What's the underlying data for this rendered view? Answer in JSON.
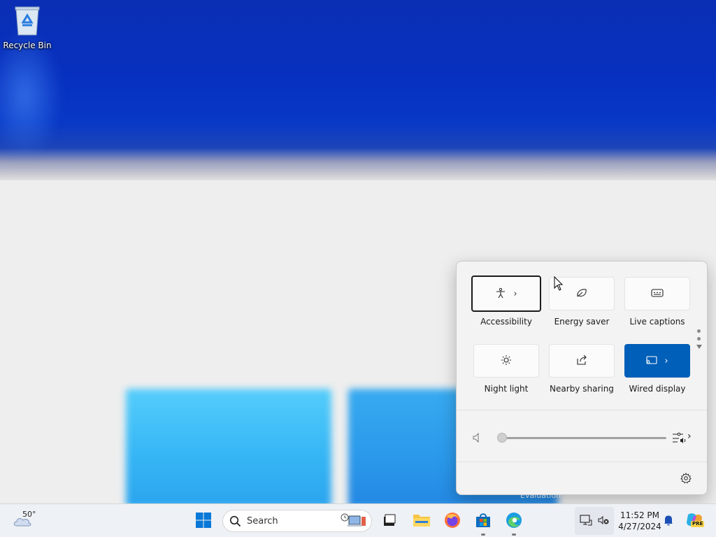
{
  "desktop": {
    "icons": [
      {
        "label": "Recycle Bin",
        "icon": "recycle-bin-icon"
      }
    ],
    "watermark": "Evaluation"
  },
  "quick_settings": {
    "tiles": [
      {
        "label": "Accessibility",
        "icon": "accessibility-icon",
        "state": "off",
        "has_chevron": true,
        "focused": true
      },
      {
        "label": "Energy saver",
        "icon": "leaf-icon",
        "state": "off",
        "has_chevron": false
      },
      {
        "label": "Live captions",
        "icon": "captions-icon",
        "state": "off",
        "has_chevron": false
      },
      {
        "label": "Night light",
        "icon": "brightness-icon",
        "state": "off",
        "has_chevron": false
      },
      {
        "label": "Nearby sharing",
        "icon": "share-icon",
        "state": "off",
        "has_chevron": false
      },
      {
        "label": "Wired display",
        "icon": "cast-icon",
        "state": "on",
        "has_chevron": true
      }
    ],
    "chevron": "›",
    "volume": {
      "level": 0,
      "icon": "speaker-icon",
      "mixer_icon": "audio-mixer-icon"
    },
    "settings_icon": "gear-icon",
    "accent_color": "#005fb8"
  },
  "taskbar": {
    "weather": {
      "temp": "50°",
      "icon": "cloudy-weather-icon"
    },
    "search": {
      "placeholder": "Search"
    },
    "apps": [
      {
        "name": "Start",
        "icon": "windows-start-icon"
      },
      {
        "name": "Task View",
        "icon": "task-view-icon"
      },
      {
        "name": "File Explorer",
        "icon": "folder-icon"
      },
      {
        "name": "Firefox",
        "icon": "firefox-icon"
      },
      {
        "name": "Microsoft Store",
        "icon": "store-icon",
        "running": true
      },
      {
        "name": "Microsoft Edge",
        "icon": "edge-icon",
        "running": true
      }
    ],
    "tray": {
      "network_icon": "network-icon",
      "volume_icon": "volume-muted-icon",
      "time": "11:52 PM",
      "date": "4/27/2024",
      "notification_icon": "bell-icon",
      "copilot_icon": "copilot-pre-icon",
      "copilot_badge": "PRE"
    }
  }
}
